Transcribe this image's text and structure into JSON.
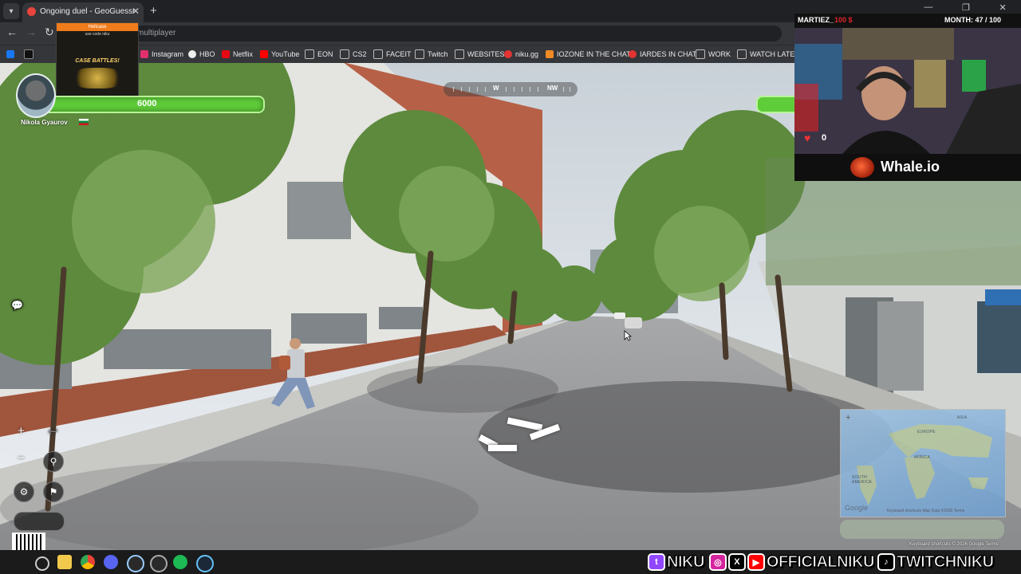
{
  "browser": {
    "tab_title": "Ongoing duel - GeoGuessr",
    "tab_close": "✕",
    "new_tab": "+",
    "url": "multiplayer",
    "window_controls": [
      "—",
      "❐",
      "✕"
    ],
    "bookmarks": [
      {
        "label": "Instagram",
        "color": "#e1306c"
      },
      {
        "label": "HBO",
        "color": "#222222"
      },
      {
        "label": "Netflix",
        "color": "#e50914"
      },
      {
        "label": "YouTube",
        "color": "#ff0000"
      },
      {
        "label": "EON",
        "color": "#bbbbbb"
      },
      {
        "label": "CS2",
        "color": "#bbbbbb"
      },
      {
        "label": "FACEIT",
        "color": "#bbbbbb"
      },
      {
        "label": "Twitch",
        "color": "#bbbbbb"
      },
      {
        "label": "WEBSITES",
        "color": "#bbbbbb"
      },
      {
        "label": "niku.gg",
        "color": "#e33333"
      },
      {
        "label": "IOZONE IN THE CHAT",
        "color": "#f08a24"
      },
      {
        "label": "IARDES IN CHAT",
        "color": "#e33333"
      },
      {
        "label": "WORK",
        "color": "#bbbbbb"
      },
      {
        "label": "WATCH LATER",
        "color": "#bbbbbb"
      }
    ]
  },
  "sponsor": {
    "header": "Hellcase",
    "code": "use code niku",
    "label": "CASE BATTLES!"
  },
  "player": {
    "name": "Nikola Gyaurov",
    "health": "6000"
  },
  "compass": {
    "labels": [
      "W",
      "NW"
    ]
  },
  "controls": {
    "zoom_in": "+",
    "zoom_out": "−",
    "pin": "⚲",
    "settings": "⚙",
    "flag": "⚑",
    "chat": "💬"
  },
  "minimap": {
    "plus": "+",
    "google": "Google",
    "footer": "Keyboard shortcuts   Map Data ©2026   Terms",
    "regions": [
      "ASIA",
      "EUROPE",
      "AFRICA",
      "SOUTH AMERICA"
    ]
  },
  "streetview_footer": "Keyboard shortcuts   © 2026 Google   Terms",
  "stream": {
    "user": "MARTIEZ_",
    "user_amount": "100 $",
    "month": "MONTH: 47 / 100",
    "heart_count": "0",
    "sponsor": "Whale.io"
  },
  "socials": {
    "twitch": "NIKU",
    "handle": "OFFICIALNIKU",
    "tiktok": "TWITCHNIKU"
  }
}
